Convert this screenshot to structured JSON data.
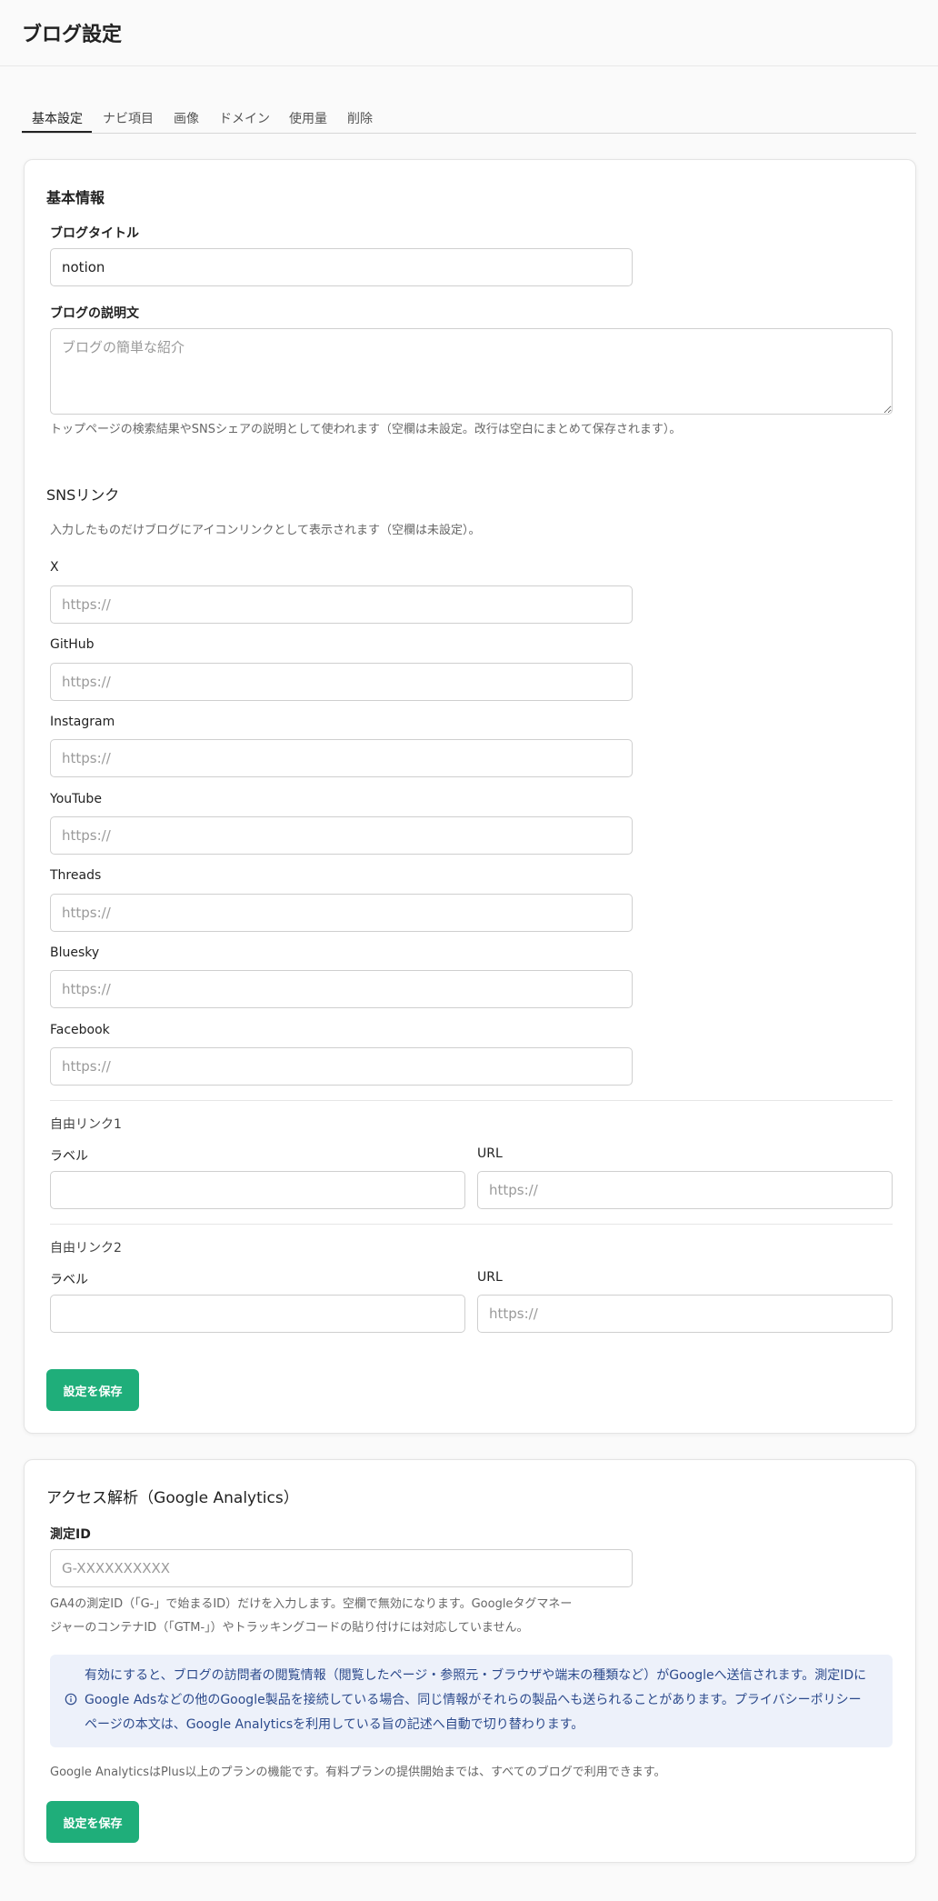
{
  "header": {
    "title": "ブログ設定"
  },
  "tabs": [
    {
      "label": "基本設定",
      "active": true
    },
    {
      "label": "ナビ項目"
    },
    {
      "label": "画像"
    },
    {
      "label": "ドメイン"
    },
    {
      "label": "使用量"
    },
    {
      "label": "削除"
    }
  ],
  "basic": {
    "heading": "基本情報",
    "title_label": "ブログタイトル",
    "title_value": "notion",
    "desc_label": "ブログの説明文",
    "desc_placeholder": "ブログの簡単な紹介",
    "desc_help": "トップページの検索結果やSNSシェアの説明として使われます（空欄は未設定。改行は空白にまとめて保存されます）。"
  },
  "sns": {
    "heading": "SNSリンク",
    "help": "入力したものだけブログにアイコンリンクとして表示されます（空欄は未設定）。",
    "url_placeholder": "https://",
    "links": [
      {
        "label": "X"
      },
      {
        "label": "GitHub"
      },
      {
        "label": "Instagram"
      },
      {
        "label": "YouTube"
      },
      {
        "label": "Threads"
      },
      {
        "label": "Bluesky"
      },
      {
        "label": "Facebook"
      }
    ],
    "custom": [
      {
        "title": "自由リンク1",
        "label_label": "ラベル",
        "url_label": "URL"
      },
      {
        "title": "自由リンク2",
        "label_label": "ラベル",
        "url_label": "URL"
      }
    ],
    "save_label": "設定を保存"
  },
  "analytics": {
    "heading": "アクセス解析（Google Analytics）",
    "id_label": "測定ID",
    "id_placeholder": "G-XXXXXXXXXX",
    "help_line1": "GA4の測定ID（「G-」で始まるID）だけを入力します。空欄で無効になります。Googleタグマネー",
    "help_line2": "ジャーのコンテナID（「GTM-」）やトラッキングコードの貼り付けには対応していません。",
    "notice_line1": "有効にすると、ブログの訪問者の閲覧情報（閲覧したページ・参照元・ブラウザや端末の種類など）がGoogleへ送信されます。測定IDに",
    "notice_line2": "Google Adsなどの他のGoogle製品を接続している場合、同じ情報がそれらの製品へも送られることがあります。プライバシーポリシー",
    "notice_line3": "ページの本文は、Google Analyticsを利用している旨の記述へ自動で切り替わります。",
    "plan_note": "Google AnalyticsはPlus以上のプランの機能です。有料プランの提供開始までは、すべてのブログで利用できます。",
    "save_label": "設定を保存"
  },
  "colors": {
    "accent": "#1fae7a",
    "notice_bg": "#edf1fa",
    "notice_text": "#2c4a8c"
  }
}
